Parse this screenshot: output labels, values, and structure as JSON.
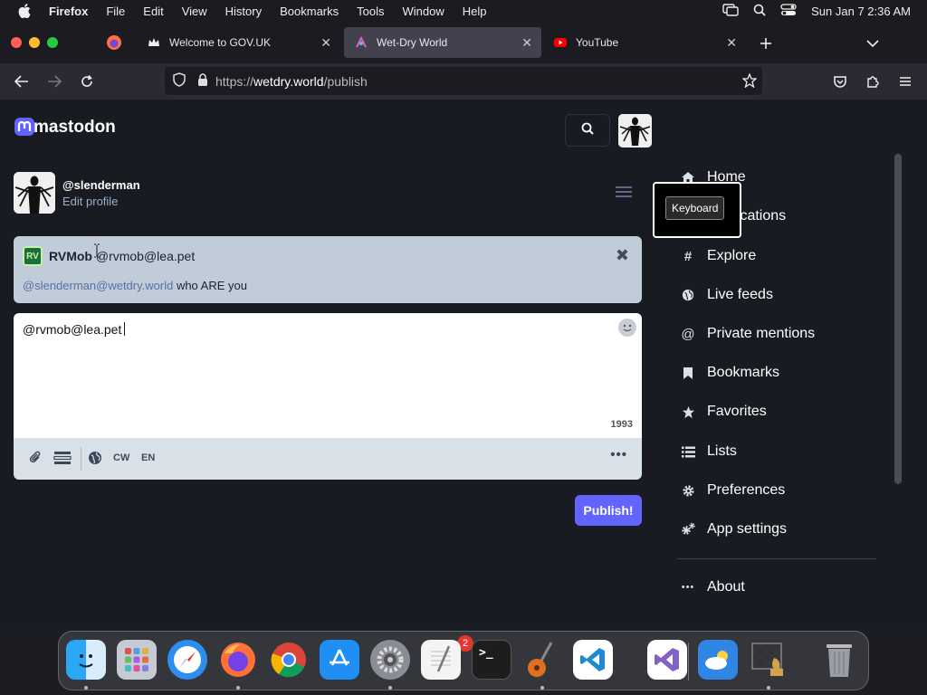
{
  "menubar": {
    "app": "Firefox",
    "items": [
      "File",
      "Edit",
      "View",
      "History",
      "Bookmarks",
      "Tools",
      "Window",
      "Help"
    ],
    "clock": "Sun Jan 7  2:36 AM"
  },
  "tabs": [
    {
      "title": "Welcome to GOV.UK"
    },
    {
      "title": "Wet-Dry World"
    },
    {
      "title": "YouTube"
    }
  ],
  "url": {
    "prefix": "https://",
    "domain": "wetdry.world",
    "path": "/publish"
  },
  "page": {
    "logo_text": "mastodon",
    "profile": {
      "handle": "@slenderman",
      "edit_label": "Edit profile"
    },
    "reply": {
      "avatar_initials": "RV",
      "display_name": "RVMob",
      "account": "@rvmob@lea.pet",
      "mention": "@slenderman@wetdry.world",
      "text": " who ARE you"
    },
    "compose": {
      "text": "@rvmob@lea.pet",
      "char_count": "1993",
      "cw_label": "CW",
      "lang_label": "EN"
    },
    "publish_label": "Publish!",
    "nav": [
      {
        "label": "Home",
        "icon": "home-icon"
      },
      {
        "label": "Notifications",
        "icon": "bell-icon"
      },
      {
        "label": "Explore",
        "icon": "hashtag-icon"
      },
      {
        "label": "Live feeds",
        "icon": "globe-icon"
      },
      {
        "label": "Private mentions",
        "icon": "at-icon"
      },
      {
        "label": "Bookmarks",
        "icon": "bookmark-icon"
      },
      {
        "label": "Favorites",
        "icon": "star-icon"
      },
      {
        "label": "Lists",
        "icon": "list-icon"
      },
      {
        "label": "Preferences",
        "icon": "gear-icon"
      },
      {
        "label": "App settings",
        "icon": "gears-icon"
      },
      {
        "label": "About",
        "icon": "ellipsis-icon"
      }
    ],
    "tooltip": "Keyboard"
  },
  "dock": {
    "settings_badge": "2"
  },
  "colors": {
    "accent": "#6364ff",
    "page_bg": "#191b22",
    "reply_bg": "#c0cdd9",
    "mention": "#5b6fa3"
  }
}
